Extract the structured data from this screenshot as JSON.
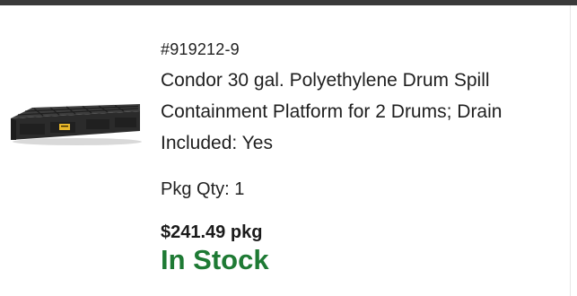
{
  "product": {
    "sku": "#919212-9",
    "title": "Condor 30 gal. Polyethylene Drum Spill Containment Platform for 2 Drums; Drain Included: Yes",
    "image_icon": "spill-containment-platform-image",
    "pkg_qty": "Pkg Qty: 1",
    "price": "$241.49 pkg",
    "availability": "In Stock"
  },
  "colors": {
    "availability": "#1e7a34",
    "header_bar": "#3a3a3a"
  }
}
